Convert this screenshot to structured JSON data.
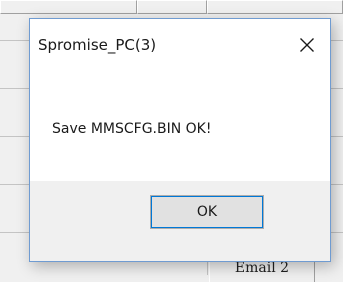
{
  "dialog": {
    "title": "Spromise_PC(3)",
    "message": "Save MMSCFG.BIN OK!",
    "ok_label": "OK",
    "close_icon": "close-icon"
  },
  "background": {
    "tab_label": "Email 2"
  },
  "colors": {
    "dialog_border": "#6f9bd1",
    "button_focus": "#0078d7",
    "button_bar_bg": "#f0f0f0",
    "content_bg": "#ffffff"
  }
}
